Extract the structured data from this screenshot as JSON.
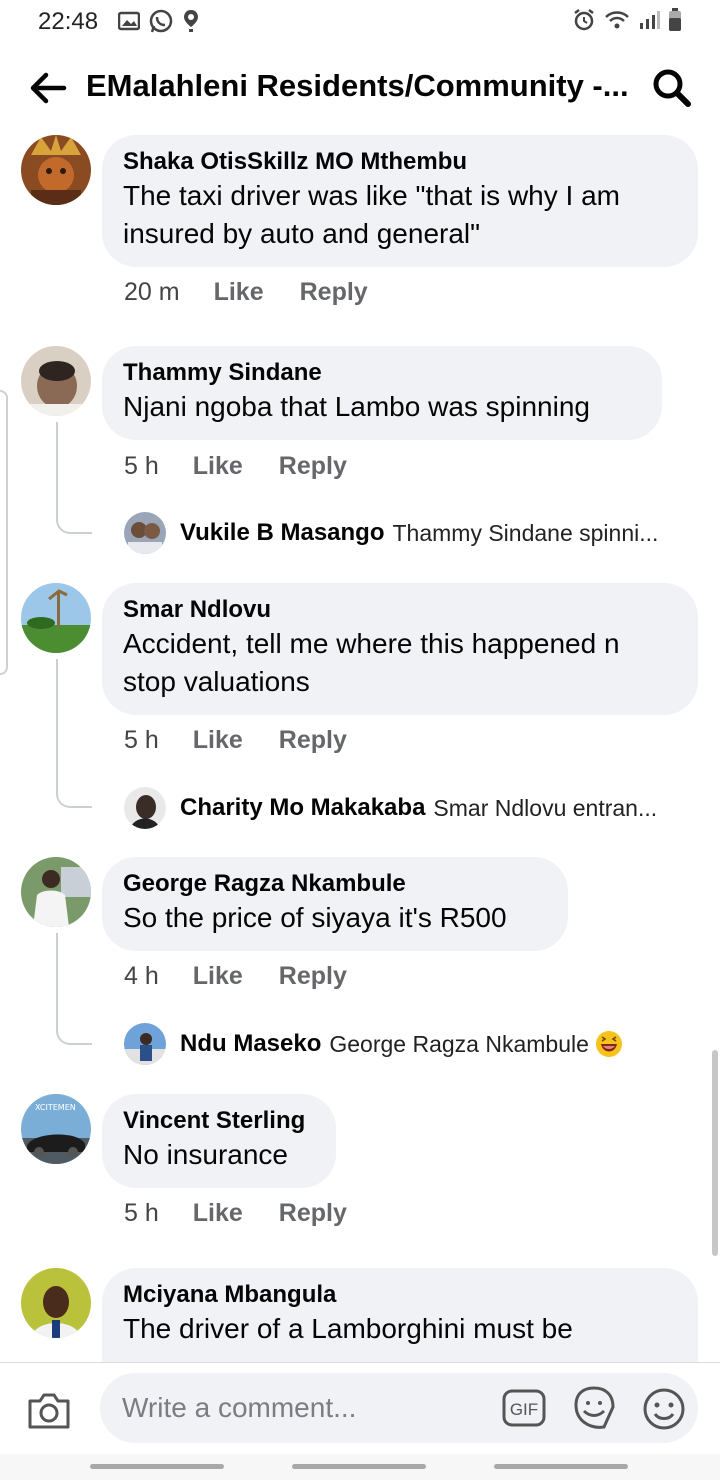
{
  "status_bar": {
    "time": "22:48"
  },
  "header": {
    "title": "EMalahleni Residents/Community -..."
  },
  "comments": [
    {
      "author": "Shaka OtisSkillz MO Mthembu",
      "text": "The taxi driver was like \"that is why I am insured by auto and general\"",
      "time": "20 m",
      "like": "Like",
      "reply": "Reply"
    },
    {
      "author": "Thammy Sindane",
      "text": "Njani ngoba that Lambo was spinning",
      "time": "5 h",
      "like": "Like",
      "reply": "Reply",
      "reply_preview": {
        "author": "Vukile B Masango",
        "text": "Thammy Sindane spinni..."
      }
    },
    {
      "author": "Smar Ndlovu",
      "text": "Accident, tell me where this happened n stop valuations",
      "time": "5 h",
      "like": "Like",
      "reply": "Reply",
      "reply_preview": {
        "author": "Charity Mo Makakaba",
        "text": "Smar Ndlovu entran..."
      }
    },
    {
      "author": "George Ragza Nkambule",
      "text": "So the price of siyaya it's R500",
      "time": "4 h",
      "like": "Like",
      "reply": "Reply",
      "reply_preview": {
        "author": "Ndu Maseko",
        "text": "George Ragza Nkambule"
      }
    },
    {
      "author": "Vincent Sterling",
      "text": "No insurance",
      "time": "5 h",
      "like": "Like",
      "reply": "Reply",
      "avatar_text": "XCITEMEN"
    },
    {
      "author": "Mciyana Mbangula",
      "text": "The driver of a Lamborghini must be"
    }
  ],
  "composer": {
    "placeholder": "Write a comment...",
    "gif_label": "GIF"
  },
  "colors": {
    "bubble": "#f0f2f5",
    "meta_text": "#65676b",
    "primary_text": "#050505"
  }
}
